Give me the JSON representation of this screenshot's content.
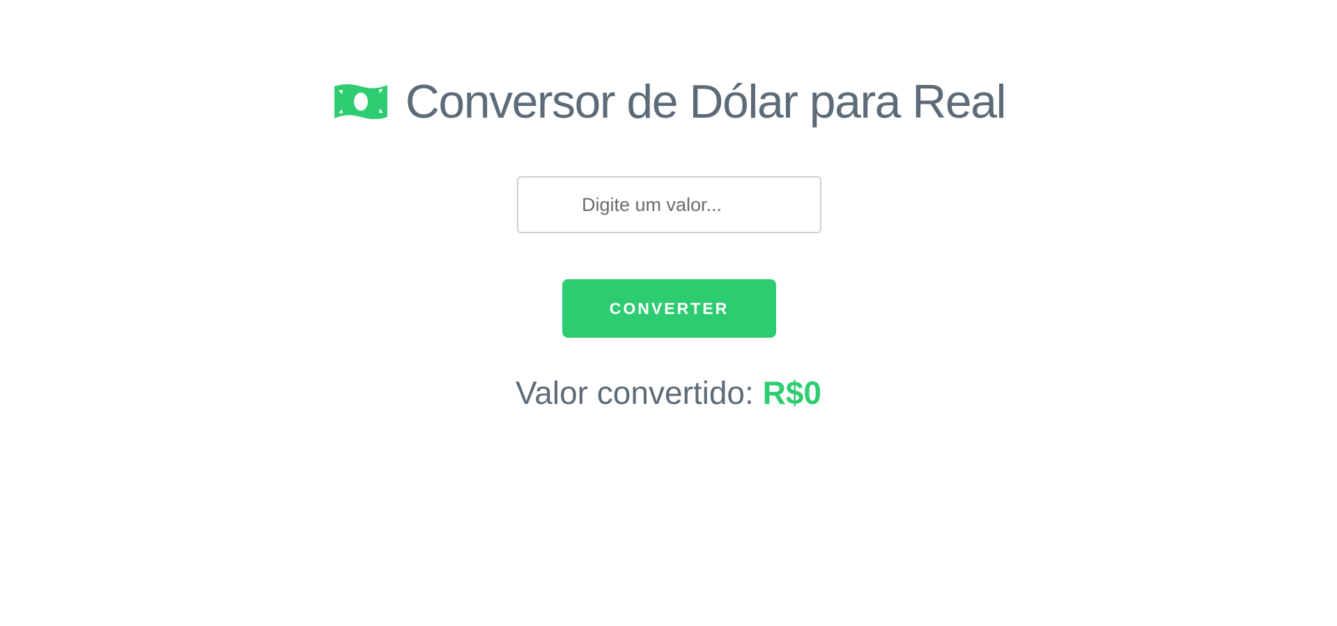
{
  "header": {
    "icon": "money-bill-icon",
    "title": "Conversor de Dólar para Real"
  },
  "form": {
    "input_value": "",
    "input_placeholder": "Digite um valor...",
    "button_label": "CONVERTER"
  },
  "result": {
    "label": "Valor convertido: ",
    "value": "R$0"
  },
  "colors": {
    "accent": "#2ecc71",
    "text": "#5d6b78",
    "input_border": "#cfcfcf"
  }
}
